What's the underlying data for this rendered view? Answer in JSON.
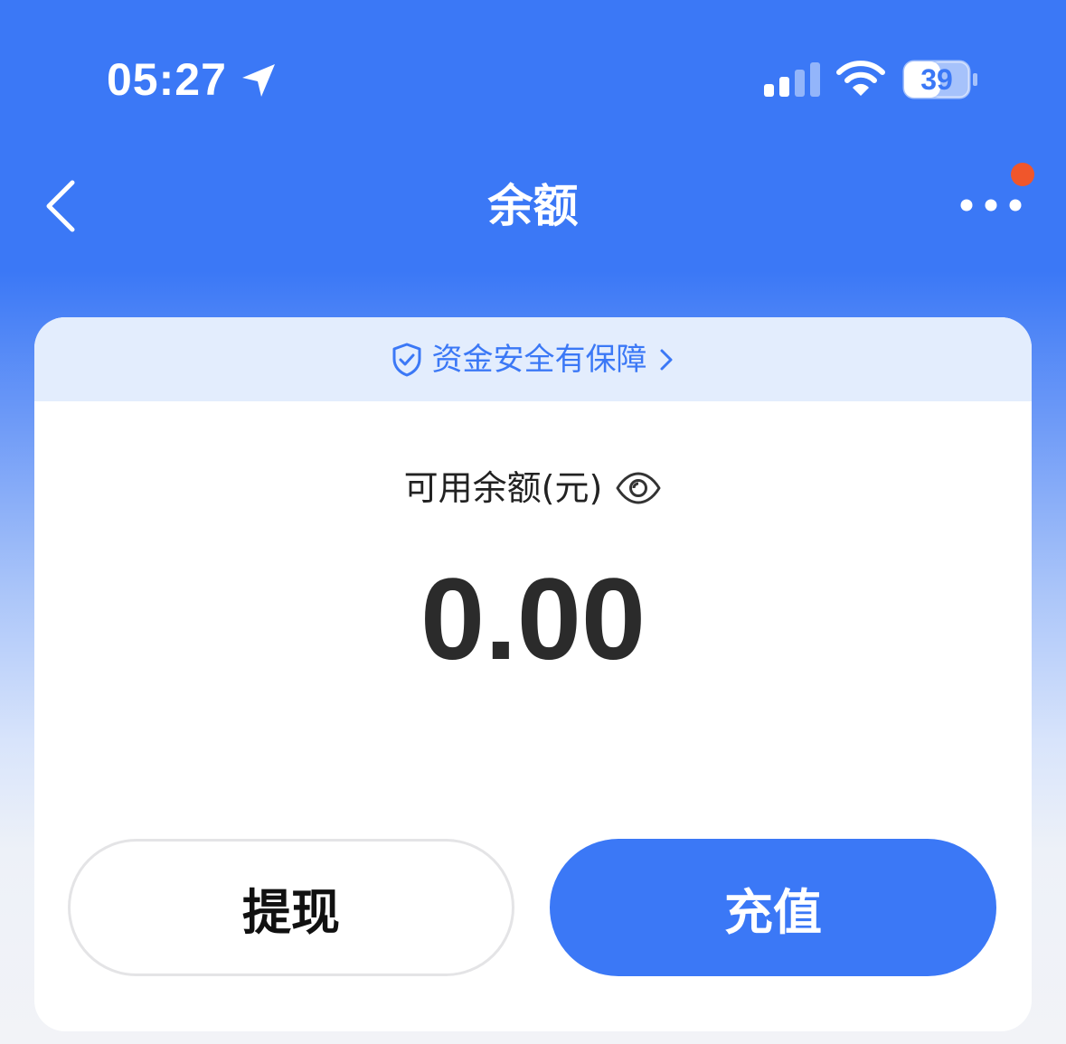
{
  "status_bar": {
    "time": "05:27",
    "battery": "39",
    "icons": [
      "location-arrow-icon",
      "cellular-signal-icon",
      "wifi-icon",
      "battery-icon"
    ]
  },
  "nav": {
    "title": "余额",
    "icons": [
      "back-chevron-icon",
      "more-dots-icon"
    ]
  },
  "security_banner": {
    "text": "资金安全有保障",
    "icons": [
      "shield-check-icon",
      "chevron-right-icon"
    ]
  },
  "balance": {
    "label": "可用余额(元)",
    "amount": "0.00",
    "icons": [
      "eye-icon"
    ]
  },
  "actions": {
    "withdraw_label": "提现",
    "recharge_label": "充值"
  },
  "colors": {
    "primary_blue": "#3b78f6",
    "banner_bg": "#e3edfd",
    "notification_dot": "#f0562b",
    "text_dark": "#2b2b2b"
  }
}
